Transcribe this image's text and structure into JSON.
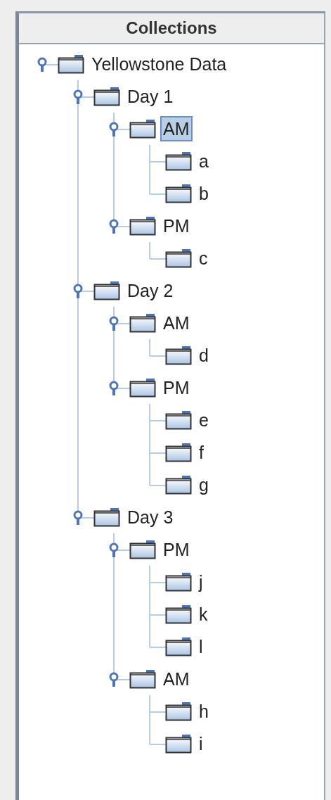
{
  "header": "Collections",
  "tree": [
    {
      "label": "Yellowstone Data",
      "selected": false,
      "expanded": true,
      "children": [
        {
          "label": "Day 1",
          "selected": false,
          "expanded": true,
          "children": [
            {
              "label": "AM",
              "selected": true,
              "expanded": true,
              "children": [
                {
                  "label": "a",
                  "selected": false
                },
                {
                  "label": "b",
                  "selected": false
                }
              ]
            },
            {
              "label": "PM",
              "selected": false,
              "expanded": true,
              "children": [
                {
                  "label": "c",
                  "selected": false
                }
              ]
            }
          ]
        },
        {
          "label": "Day 2",
          "selected": false,
          "expanded": true,
          "children": [
            {
              "label": "AM",
              "selected": false,
              "expanded": true,
              "children": [
                {
                  "label": "d",
                  "selected": false
                }
              ]
            },
            {
              "label": "PM",
              "selected": false,
              "expanded": true,
              "children": [
                {
                  "label": "e",
                  "selected": false
                },
                {
                  "label": "f",
                  "selected": false
                },
                {
                  "label": "g",
                  "selected": false
                }
              ]
            }
          ]
        },
        {
          "label": "Day 3",
          "selected": false,
          "expanded": true,
          "children": [
            {
              "label": "PM",
              "selected": false,
              "expanded": true,
              "children": [
                {
                  "label": "j",
                  "selected": false
                },
                {
                  "label": "k",
                  "selected": false
                },
                {
                  "label": "l",
                  "selected": false
                }
              ]
            },
            {
              "label": "AM",
              "selected": false,
              "expanded": true,
              "children": [
                {
                  "label": "h",
                  "selected": false
                },
                {
                  "label": "i",
                  "selected": false
                }
              ]
            }
          ]
        }
      ]
    }
  ]
}
